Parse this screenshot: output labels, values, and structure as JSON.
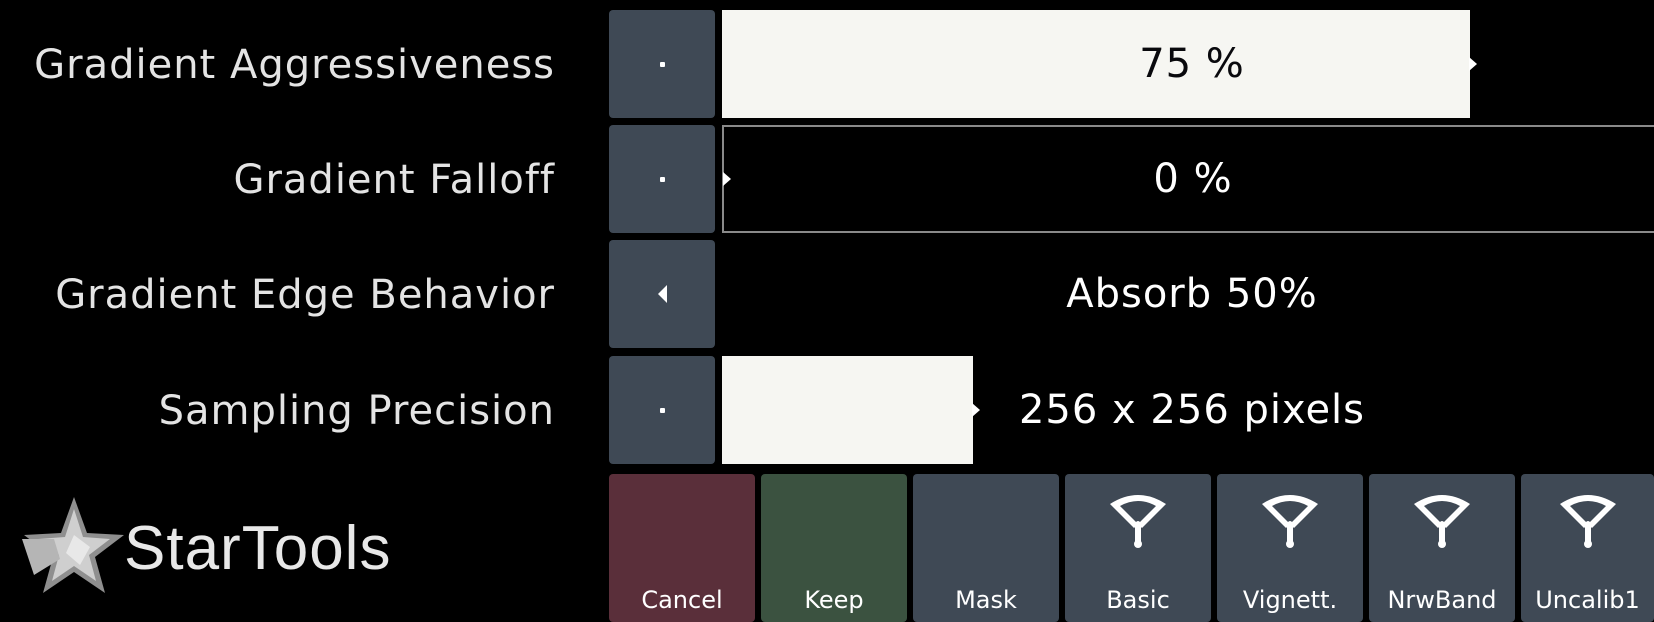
{
  "parameters": [
    {
      "label": "Gradient Aggressiveness",
      "value": "75 %",
      "level": 0.796,
      "decrement_icon": "dot-icon"
    },
    {
      "label": "Gradient Falloff",
      "value": "0 %",
      "level": 0,
      "decrement_icon": "dot-icon"
    },
    {
      "label": "Gradient Edge Behavior",
      "value": "Absorb 50%",
      "decrement_icon": "triangle-left-icon"
    },
    {
      "label": "Sampling Precision",
      "value": "256 x 256 pixels",
      "level": 0.267,
      "decrement_icon": "dot-icon"
    }
  ],
  "buttons": {
    "cancel": "Cancel",
    "keep": "Keep",
    "mask": "Mask",
    "presets": [
      {
        "label": "Basic",
        "icon": "wiper-icon"
      },
      {
        "label": "Vignett.",
        "icon": "wiper-icon"
      },
      {
        "label": "NrwBand",
        "icon": "wiper-icon"
      },
      {
        "label": "Uncalib1",
        "icon": "wiper-icon"
      }
    ]
  },
  "logo": {
    "text": "StarTools",
    "icon": "star-logo-icon"
  },
  "colors": {
    "background": "#000000",
    "button_default": "#3f4955",
    "button_cancel": "#5a2f3a",
    "button_keep": "#3b5240",
    "slider_fill": "#f6f6f2",
    "text": "#e6e6e6"
  }
}
